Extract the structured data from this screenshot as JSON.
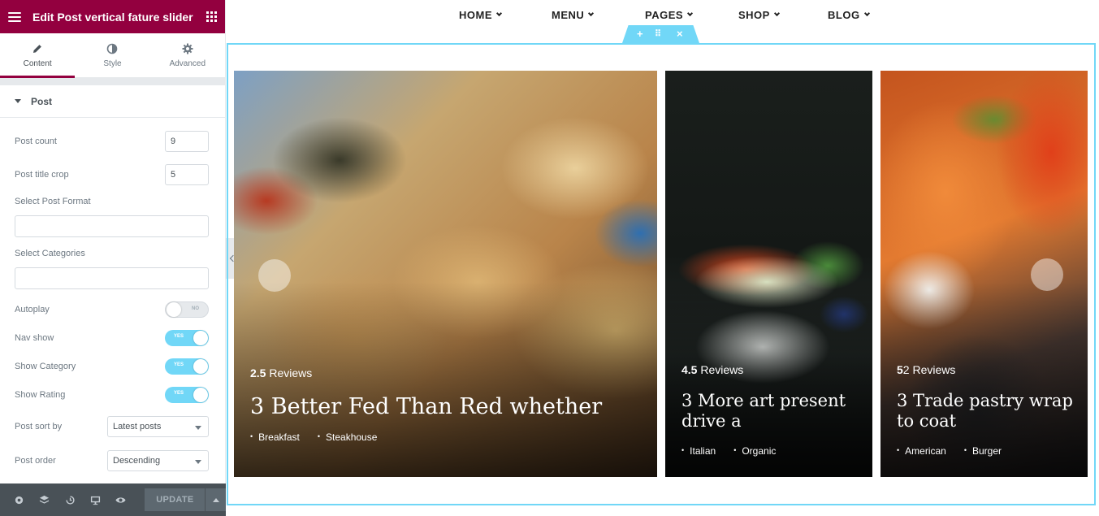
{
  "sidebar": {
    "title": "Edit Post vertical fature slider",
    "tabs": [
      {
        "label": "Content",
        "icon": "pencil-icon"
      },
      {
        "label": "Style",
        "icon": "half-circle-icon"
      },
      {
        "label": "Advanced",
        "icon": "gear-icon"
      }
    ],
    "section_title": "Post",
    "controls": {
      "post_count": {
        "label": "Post count",
        "value": "9"
      },
      "post_title_crop": {
        "label": "Post title crop",
        "value": "5"
      },
      "post_format": {
        "label": "Select Post Format",
        "value": ""
      },
      "categories": {
        "label": "Select Categories",
        "value": ""
      },
      "autoplay": {
        "label": "Autoplay",
        "state": "NO"
      },
      "nav_show": {
        "label": "Nav show",
        "state": "YES"
      },
      "show_category": {
        "label": "Show Category",
        "state": "YES"
      },
      "show_rating": {
        "label": "Show Rating",
        "state": "YES"
      },
      "post_sort_by": {
        "label": "Post sort by",
        "value": "Latest posts"
      },
      "post_order": {
        "label": "Post order",
        "value": "Descending"
      }
    },
    "footer": {
      "update_label": "UPDATE"
    }
  },
  "nav": {
    "items": [
      "HOME",
      "MENU",
      "PAGES",
      "SHOP",
      "BLOG"
    ]
  },
  "section_handle": {
    "add": "+",
    "move": "⠿",
    "close": "×"
  },
  "cards": [
    {
      "rating": "2.5",
      "reviews": "Reviews",
      "title": "3 Better Fed Than Red whether",
      "categories": [
        "Breakfast",
        "Steakhouse"
      ]
    },
    {
      "rating": "4.5",
      "reviews": "Reviews",
      "title": "3 More art present drive a",
      "categories": [
        "Italian",
        "Organic"
      ]
    },
    {
      "rating": "5",
      "reviews": "2 Reviews",
      "title": "3 Trade pastry wrap to coat",
      "categories": [
        "American",
        "Burger"
      ]
    }
  ],
  "colors": {
    "brand": "#93003f",
    "accent": "#71d7f7",
    "footer": "#495157"
  }
}
